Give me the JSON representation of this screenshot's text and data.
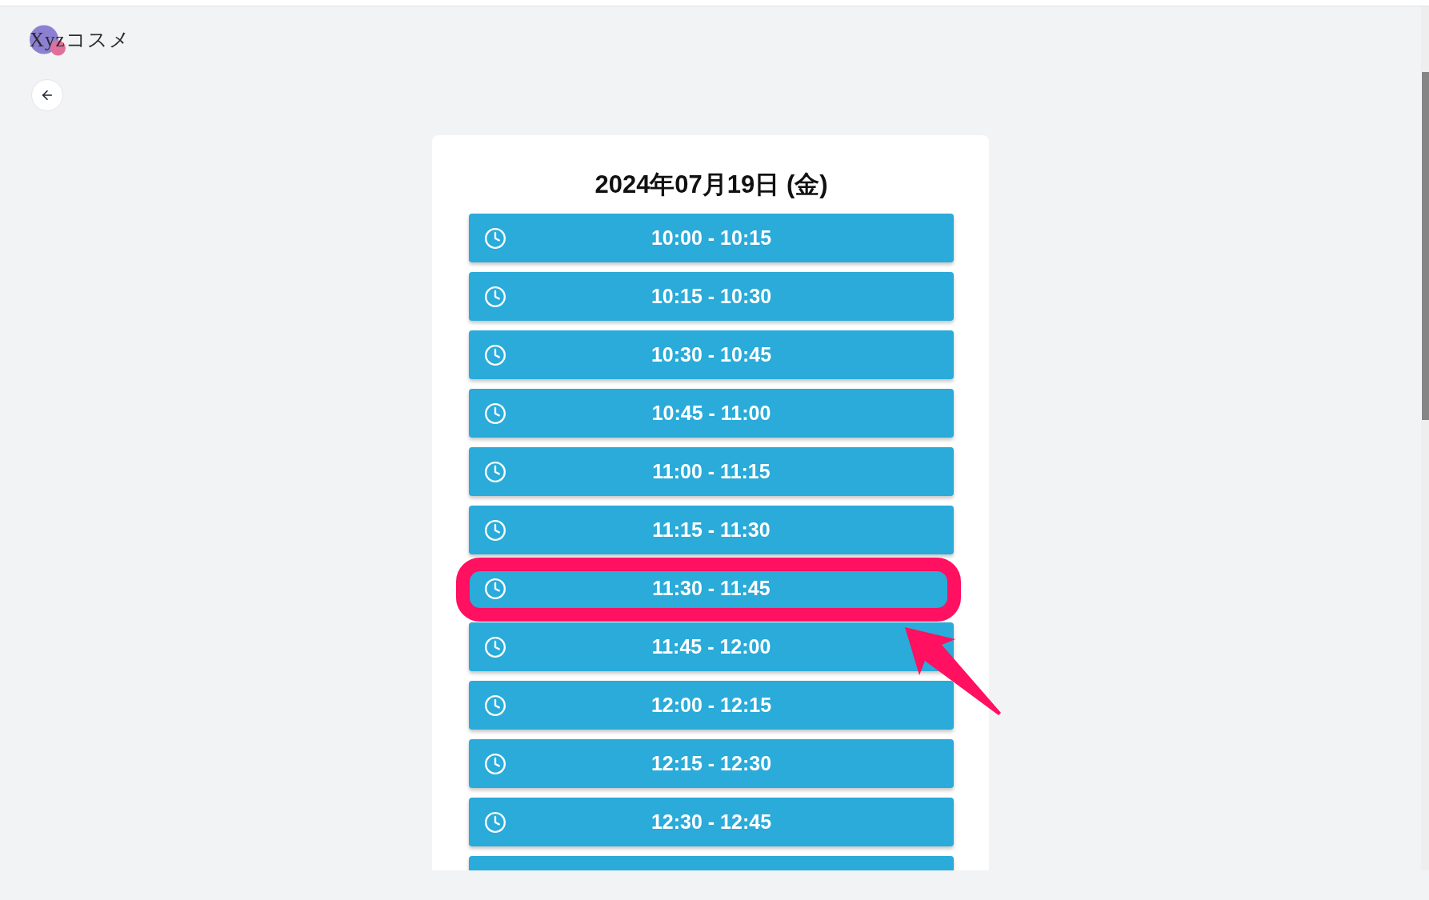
{
  "brand": {
    "name": "Xyzコスメ"
  },
  "date_title": "2024年07月19日 (金)",
  "slots": [
    {
      "label": "10:00 - 10:15",
      "highlighted": false
    },
    {
      "label": "10:15 - 10:30",
      "highlighted": false
    },
    {
      "label": "10:30 - 10:45",
      "highlighted": false
    },
    {
      "label": "10:45 - 11:00",
      "highlighted": false
    },
    {
      "label": "11:00 - 11:15",
      "highlighted": false
    },
    {
      "label": "11:15 - 11:30",
      "highlighted": false
    },
    {
      "label": "11:30 - 11:45",
      "highlighted": true
    },
    {
      "label": "11:45 - 12:00",
      "highlighted": false
    },
    {
      "label": "12:00 - 12:15",
      "highlighted": false
    },
    {
      "label": "12:15 - 12:30",
      "highlighted": false
    },
    {
      "label": "12:30 - 12:45",
      "highlighted": false
    },
    {
      "highlighted": false
    }
  ]
}
